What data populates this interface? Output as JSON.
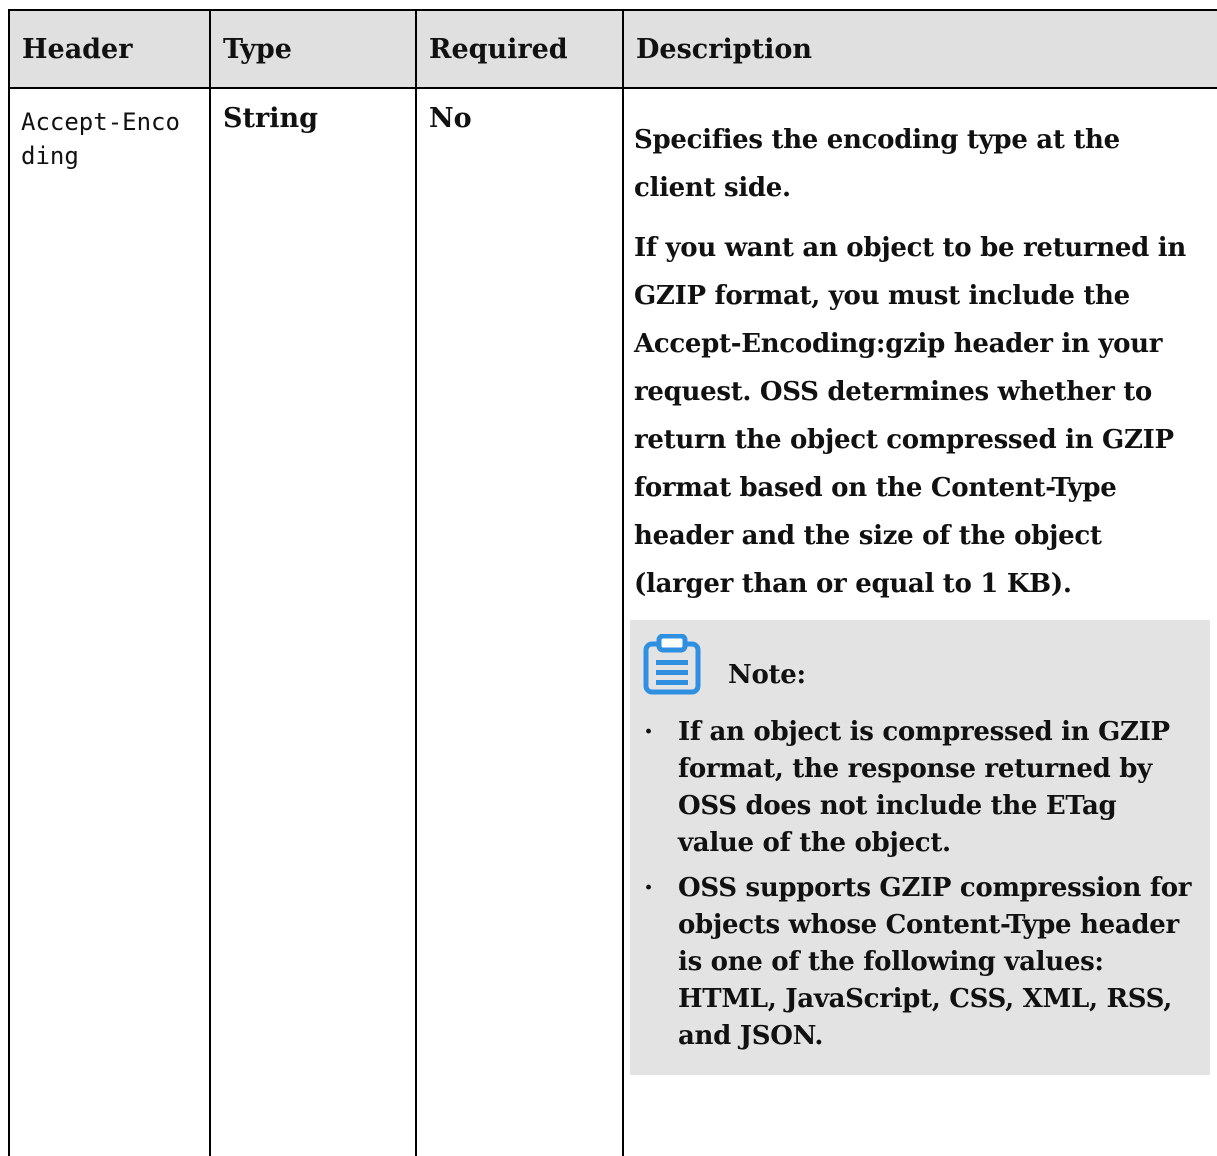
{
  "table": {
    "headers": [
      "Header",
      "Type",
      "Required",
      "Description"
    ],
    "row": {
      "header": "Accept-Encoding",
      "type": "String",
      "required": "No",
      "description": {
        "p1": "Specifies the encoding type at the client side.",
        "p2": "If you want an object to be returned in GZIP format, you must include the Accept-Encoding:gzip header in your request. OSS determines whether to return the object compressed in GZIP format based on the Content-Type header and the size of the object (larger than or equal to 1 KB).",
        "note": {
          "icon": "note-clipboard-icon",
          "label": "Note:",
          "bullet_symbol": "·",
          "items": [
            "If an object is compressed in GZIP format, the response returned by OSS does not include the ETag value of the object.",
            "OSS supports GZIP compression for objects whose Content-Type header is one of the following values: HTML, JavaScript, CSS, XML, RSS, and JSON."
          ]
        }
      }
    }
  },
  "colors": {
    "header_bg": "#e0e0e0",
    "note_bg": "#e3e3e3",
    "icon_blue": "#2f8fe0",
    "border": "#000000"
  }
}
